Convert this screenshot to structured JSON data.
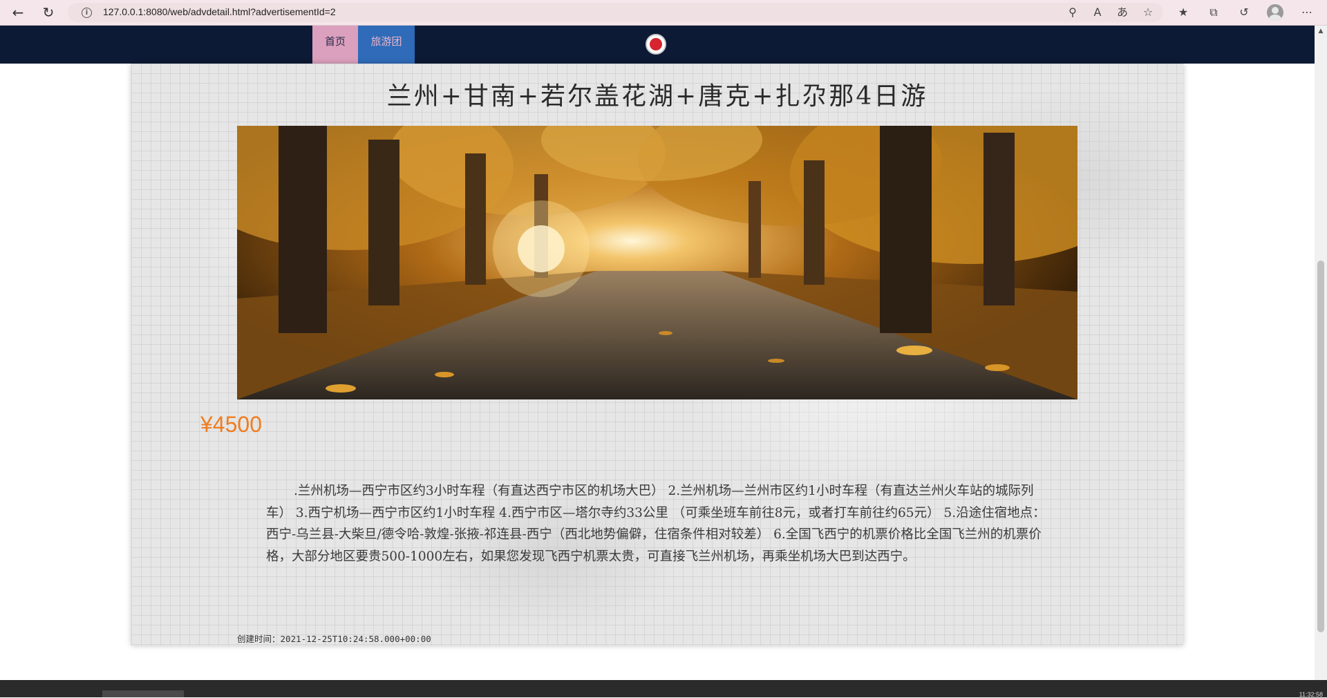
{
  "browser": {
    "url": "127.0.0.1:8080/web/advdetail.html?advertisementId=2",
    "back_icon": "back-arrow-icon",
    "refresh_icon": "refresh-icon",
    "info_icon": "site-info-icon",
    "read_aloud_label": "A",
    "translate_label": "あ"
  },
  "site_nav": {
    "home_label": "首页",
    "tour_label": "旅游团",
    "home_color": "#dba0bd",
    "tour_color": "#2f6bb8"
  },
  "advertisement": {
    "title": "兰州+甘南+若尔盖花湖+唐克+扎尕那4日游",
    "image_alt": "autumn forest road",
    "price": "¥4500",
    "description": ".兰州机场—西宁市区约3小时车程（有直达西宁市区的机场大巴） 2.兰州机场—兰州市区约1小时车程（有直达兰州火车站的城际列车） 3.西宁机场—西宁市区约1小时车程 4.西宁市区—塔尔寺约33公里 （可乘坐班车前往8元，或者打车前往约65元） 5.沿途住宿地点：西宁-乌兰县-大柴旦/德令哈-敦煌-张掖-祁连县-西宁（西北地势偏僻，住宿条件相对较差） 6.全国飞西宁的机票价格比全国飞兰州的机票价格，大部分地区要贵500-1000左右，如果您发现飞西宁机票太贵，可直接飞兰州机场，再乘坐机场大巴到达西宁。",
    "created_label": "创建时间：",
    "created_value": "2021-12-25T10:24:58.000+00:00"
  },
  "taskbar": {
    "clock": "11:32:58"
  }
}
